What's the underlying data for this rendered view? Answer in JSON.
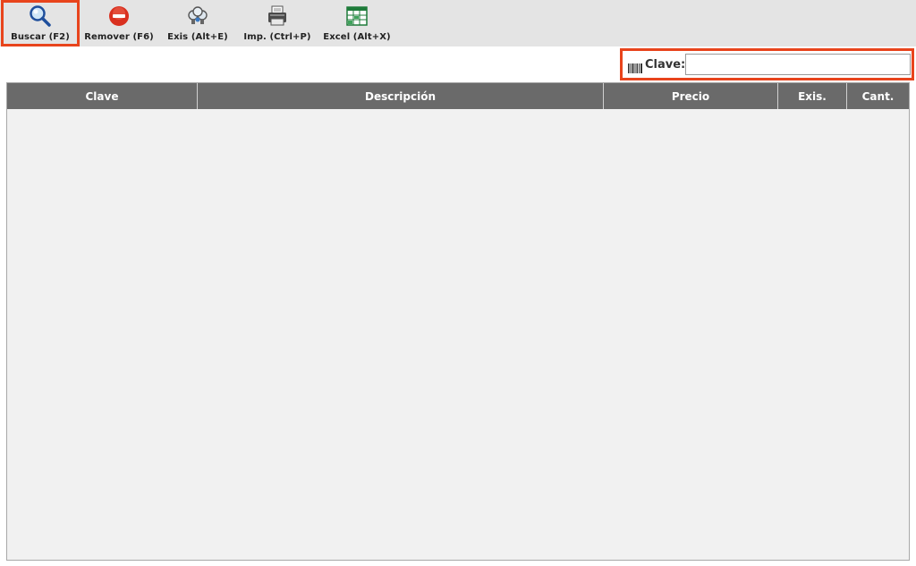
{
  "toolbar": {
    "buttons": [
      {
        "label": "Buscar (F2)",
        "icon": "magnifier-icon"
      },
      {
        "label": "Remover (F6)",
        "icon": "remove-icon"
      },
      {
        "label": "Exis (Alt+E)",
        "icon": "stock-icon"
      },
      {
        "label": "Imp. (Ctrl+P)",
        "icon": "printer-icon"
      },
      {
        "label": "Excel (Alt+X)",
        "icon": "excel-icon"
      }
    ]
  },
  "search": {
    "label": "Clave:",
    "value": "",
    "icon": "barcode-icon"
  },
  "table": {
    "columns": [
      "Clave",
      "Descripción",
      "Precio",
      "Exis.",
      "Cant."
    ],
    "rows": []
  },
  "colors": {
    "highlight": "#e8441c",
    "header_bg": "#6a6a6a",
    "toolbar_bg": "#e4e4e4",
    "grid_bg": "#f1f1f1"
  }
}
